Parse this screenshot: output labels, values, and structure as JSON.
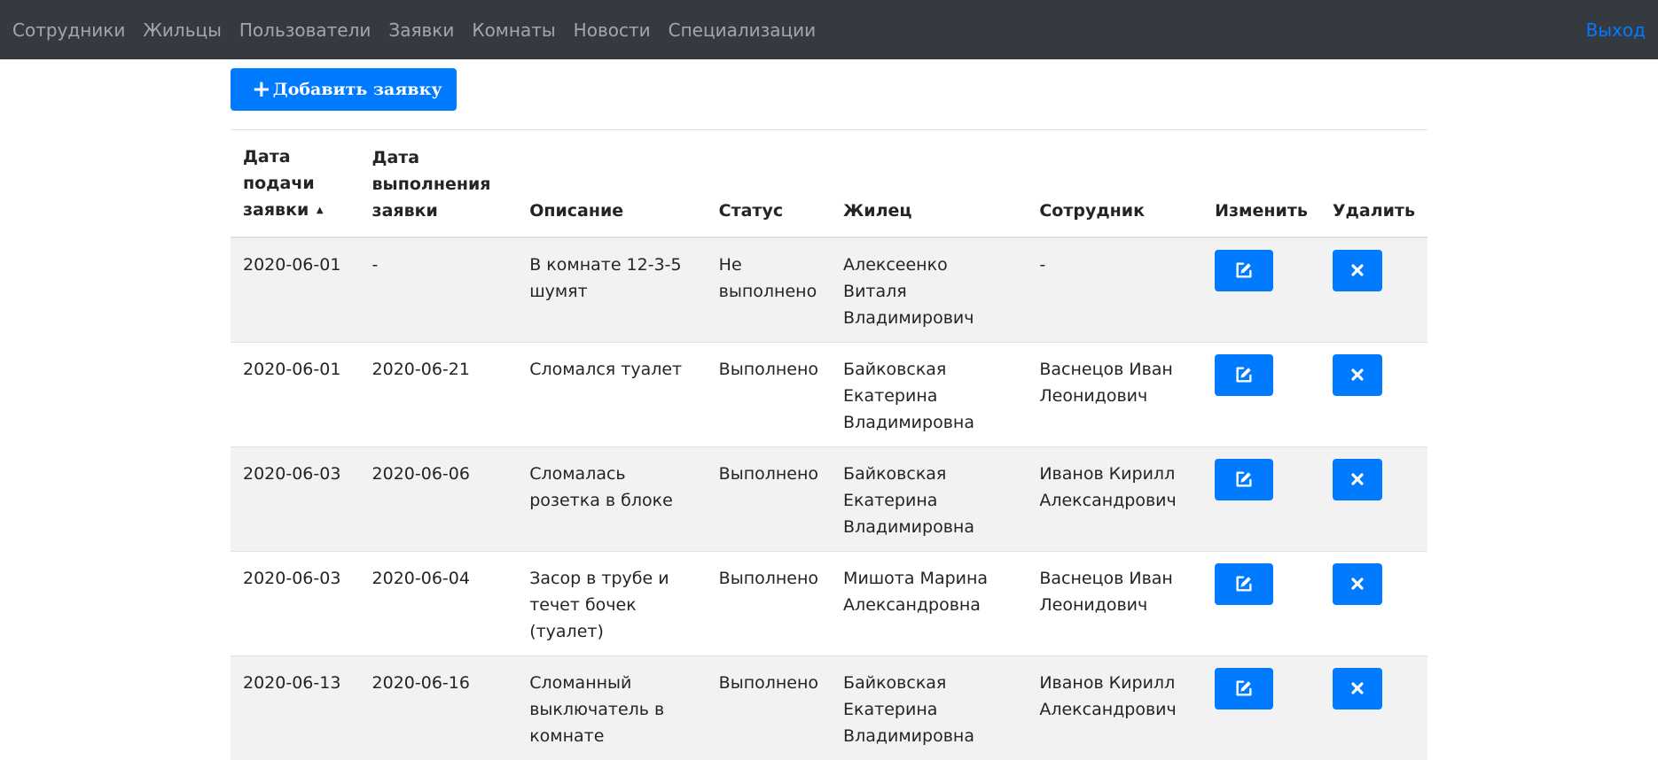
{
  "nav": {
    "links": [
      "Сотрудники",
      "Жильцы",
      "Пользователи",
      "Заявки",
      "Комнаты",
      "Новости",
      "Специализации"
    ],
    "logout": "Выход"
  },
  "toolbar": {
    "add_label": "Добавить заявку"
  },
  "table": {
    "headers": {
      "date_submit": "Дата подачи заявки",
      "sort_icon": "▲",
      "date_done": "Дата выполнения заявки",
      "description": "Описание",
      "status": "Статус",
      "resident": "Жилец",
      "employee": "Сотрудник",
      "edit": "Изменить",
      "delete": "Удалить"
    },
    "rows": [
      {
        "date_submit": "2020-06-01",
        "date_done": "-",
        "description": "В комнате 12-3-5 шумят",
        "status": "Не выполнено",
        "resident": "Алексеенко Виталя Владимирович",
        "employee": "-"
      },
      {
        "date_submit": "2020-06-01",
        "date_done": "2020-06-21",
        "description": "Сломался туалет",
        "status": "Выполнено",
        "resident": "Байковская Екатерина Владимировна",
        "employee": "Васнецов Иван Леонидович"
      },
      {
        "date_submit": "2020-06-03",
        "date_done": "2020-06-06",
        "description": "Сломалась розетка в блоке",
        "status": "Выполнено",
        "resident": "Байковская Екатерина Владимировна",
        "employee": "Иванов Кирилл Александрович"
      },
      {
        "date_submit": "2020-06-03",
        "date_done": "2020-06-04",
        "description": "Засор в трубе и течет бочек (туалет)",
        "status": "Выполнено",
        "resident": "Мишота Марина Александровна",
        "employee": "Васнецов Иван Леонидович"
      },
      {
        "date_submit": "2020-06-13",
        "date_done": "2020-06-16",
        "description": "Сломанный выключатель в комнате",
        "status": "Выполнено",
        "resident": "Байковская Екатерина Владимировна",
        "employee": "Иванов Кирилл Александрович"
      }
    ]
  },
  "colors": {
    "navbar": "#343a40",
    "primary": "#007bff",
    "stripe": "#f2f2f2"
  },
  "icons": {
    "add": "plus-icon",
    "edit": "edit-icon",
    "delete": "close-icon"
  }
}
